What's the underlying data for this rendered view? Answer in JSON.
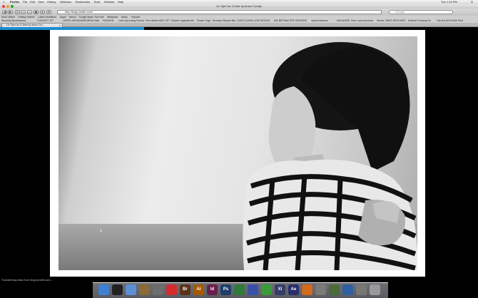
{
  "menubar": {
    "apple": "",
    "items": [
      "Firefox",
      "File",
      "Edit",
      "View",
      "History",
      "Delicious",
      "Bookmarks",
      "Tools",
      "Window",
      "Help"
    ],
    "clock": "Tue 1:14 PM"
  },
  "window": {
    "title": "Liv Tyler for G-Star by Anton Corbijn"
  },
  "toolbar": {
    "back_icon": "back-arrow-icon",
    "url": "http://tlctg.tumblr.com/",
    "search_placeholder": "Google"
  },
  "bookmarks": [
    "Most Visited",
    "Getting Started",
    "Latest Headlines",
    "Apple",
    "Yahoo!",
    "Google Maps",
    "YouTube",
    "Wikipedia",
    "News",
    "Popular"
  ],
  "bookmarks2": [
    "Recently Bookmarked",
    "CONTACT S/T",
    "UNITEL AROUND/BOX",
    "Print links",
    "FASHION",
    "Lush Upcoming Events",
    "Free Adobe ANY LIFT",
    "Miracle Upgrade link",
    "Flower Yoga",
    "Brooklyn Bicycle Bar",
    "CASS CLEAN LIGHT",
    "BOOKS",
    "INK BRT",
    "Well SITE DESIGNS",
    "visual business",
    "MAGAZINE",
    "Here I sensual clear",
    "Words",
    "PAINT ARCHIVES",
    "Minimal Scriptogr.fm",
    "Old Ans ANYHOW Print"
  ],
  "tab": {
    "label": "Liv Tyler for G-Star by Anton Cor..."
  },
  "page": {
    "prev_arrow": "‹"
  },
  "status": {
    "text": "Transferring data from tlctg.tumblr.com..."
  },
  "dock": {
    "items": [
      {
        "name": "finder-icon",
        "label": "",
        "color": "#3e7fd1"
      },
      {
        "name": "dashboard-icon",
        "label": "",
        "color": "#222222"
      },
      {
        "name": "safari-icon",
        "label": "",
        "color": "#5a8fd6"
      },
      {
        "name": "iphoto-icon",
        "label": "",
        "color": "#8a6a3a"
      },
      {
        "name": "utility-icon",
        "label": "",
        "color": "#6d6d6d"
      },
      {
        "name": "acrobat-icon",
        "label": "",
        "color": "#d22b2b"
      },
      {
        "name": "bridge-icon",
        "label": "Br",
        "color": "#5c3318"
      },
      {
        "name": "illustrator-icon",
        "label": "Ai",
        "color": "#a65a00"
      },
      {
        "name": "indesign-icon",
        "label": "Id",
        "color": "#6a1e4e"
      },
      {
        "name": "photoshop-icon",
        "label": "Ps",
        "color": "#1d3d6b"
      },
      {
        "name": "dreamweaver-icon",
        "label": "",
        "color": "#2e7a3a"
      },
      {
        "name": "itunes-icon",
        "label": "",
        "color": "#3a4fa8"
      },
      {
        "name": "green-app-icon",
        "label": "",
        "color": "#3a9a3a"
      },
      {
        "name": "xcode-icon",
        "label": "Xl",
        "color": "#333c6b"
      },
      {
        "name": "aftereffects-icon",
        "label": "Ae",
        "color": "#2a2e6a"
      },
      {
        "name": "firefox-icon",
        "label": "",
        "color": "#d2691e"
      },
      {
        "name": "preview-icon",
        "label": "",
        "color": "#7a7a7a"
      },
      {
        "name": "stats-icon",
        "label": "",
        "color": "#4a6a3a"
      },
      {
        "name": "monitor-icon",
        "label": "",
        "color": "#2f5fa0"
      },
      {
        "name": "preferences-icon",
        "label": "",
        "color": "#777777"
      },
      {
        "name": "trash-icon",
        "label": "",
        "color": "#999999"
      }
    ]
  },
  "colors": {
    "progress": "#1c8dd0"
  }
}
